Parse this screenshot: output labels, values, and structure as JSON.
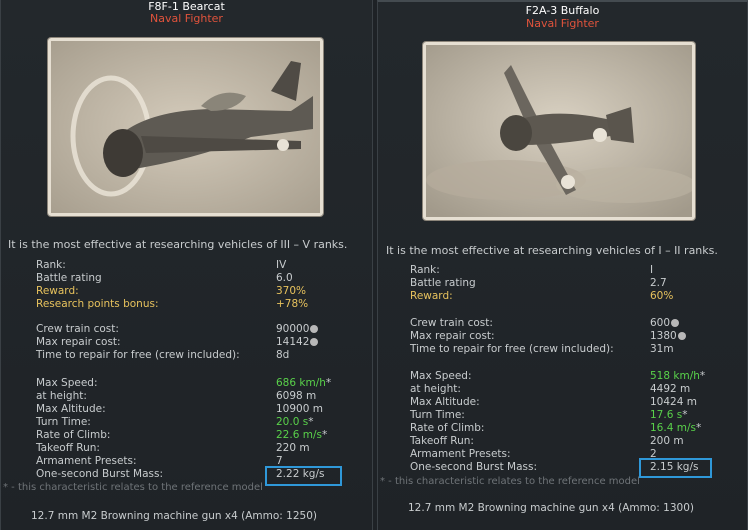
{
  "cards": [
    {
      "name": "F8F-1 Bearcat",
      "role": "Naval Fighter",
      "photo_description": "aircraft-photo",
      "research_note": "It is the most effective at researching vehicles of III – V ranks.",
      "stats1": [
        {
          "label": "Rank:",
          "value": "IV",
          "style": "w"
        },
        {
          "label": "Battle rating",
          "value": "6.0",
          "style": "w"
        },
        {
          "label": "Reward:",
          "value": "370%",
          "style": "y"
        },
        {
          "label": "Research points bonus:",
          "value": "+78%",
          "style": "y"
        }
      ],
      "stats2": [
        {
          "label": "Crew train cost:",
          "value": "90000",
          "currency": true
        },
        {
          "label": "Max repair cost:",
          "value": "14142",
          "currency": true
        },
        {
          "label": "Time to repair for free (crew included):",
          "value": "8d",
          "currency": false
        }
      ],
      "stats3": [
        {
          "label": "Max Speed:",
          "value": "686 km/h",
          "style": "g",
          "star": true
        },
        {
          "label": "at height:",
          "value": "6098 m",
          "style": "w",
          "star": false
        },
        {
          "label": "Max Altitude:",
          "value": "10900 m",
          "style": "w",
          "star": false
        },
        {
          "label": "Turn Time:",
          "value": "20.0 s",
          "style": "g",
          "star": true
        },
        {
          "label": "Rate of Climb:",
          "value": "22.6 m/s",
          "style": "g",
          "star": true
        },
        {
          "label": "Takeoff Run:",
          "value": "220 m",
          "style": "w",
          "star": false
        },
        {
          "label": "Armament Presets:",
          "value": "7",
          "style": "w",
          "star": false
        },
        {
          "label": "One-second Burst Mass:",
          "value": "2.22 kg/s",
          "style": "w",
          "star": false
        }
      ],
      "footnote": "* - this characteristic relates to the reference model",
      "weapon": "12.7 mm M2 Browning machine gun x4 (Ammo: 1250)"
    },
    {
      "name": "F2A-3 Buffalo",
      "role": "Naval Fighter",
      "photo_description": "aircraft-photo",
      "research_note": "It is the most effective at researching vehicles of I – II ranks.",
      "stats1": [
        {
          "label": "Rank:",
          "value": "I",
          "style": "w"
        },
        {
          "label": "Battle rating",
          "value": "2.7",
          "style": "w"
        },
        {
          "label": "Reward:",
          "value": "60%",
          "style": "y"
        }
      ],
      "stats2": [
        {
          "label": "Crew train cost:",
          "value": "600",
          "currency": true
        },
        {
          "label": "Max repair cost:",
          "value": "1380",
          "currency": true
        },
        {
          "label": "Time to repair for free (crew included):",
          "value": "31m",
          "currency": false
        }
      ],
      "stats3": [
        {
          "label": "Max Speed:",
          "value": "518 km/h",
          "style": "g",
          "star": true
        },
        {
          "label": "at height:",
          "value": "4492 m",
          "style": "w",
          "star": false
        },
        {
          "label": "Max Altitude:",
          "value": "10424 m",
          "style": "w",
          "star": false
        },
        {
          "label": "Turn Time:",
          "value": "17.6 s",
          "style": "g",
          "star": true
        },
        {
          "label": "Rate of Climb:",
          "value": "16.4 m/s",
          "style": "g",
          "star": true
        },
        {
          "label": "Takeoff Run:",
          "value": "200 m",
          "style": "w",
          "star": false
        },
        {
          "label": "Armament Presets:",
          "value": "2",
          "style": "w",
          "star": false
        },
        {
          "label": "One-second Burst Mass:",
          "value": "2.15 kg/s",
          "style": "w",
          "star": false
        }
      ],
      "footnote": "* - this characteristic relates to the reference model",
      "weapon": "12.7 mm M2 Browning machine gun x4 (Ammo: 1300)"
    }
  ],
  "colors": {
    "role": "#e0533c",
    "reward": "#e7c25d",
    "good_stat": "#59d14a",
    "highlight": "#2f98d9"
  }
}
